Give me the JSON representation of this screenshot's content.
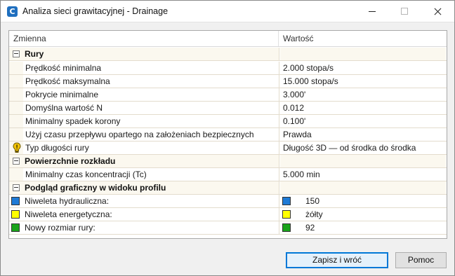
{
  "window": {
    "title": "Analiza sieci grawitacyjnej - Drainage",
    "app_icon": "C",
    "controls": [
      "minimize-icon",
      "maximize-icon",
      "close-icon"
    ]
  },
  "grid": {
    "columns": [
      "Zmienna",
      "Wartość"
    ],
    "categories": [
      {
        "label": "Rury",
        "rows": [
          {
            "label": "Prędkość minimalna",
            "value": "2.000 stopa/s"
          },
          {
            "label": "Prędkość maksymalna",
            "value": "15.000 stopa/s"
          },
          {
            "label": "Pokrycie minimalne",
            "value": "3.000'"
          },
          {
            "label": "Domyślna wartość N",
            "value": "0.012"
          },
          {
            "label": "Minimalny spadek korony",
            "value": "0.100'"
          },
          {
            "label": "Użyj czasu przepływu opartego na założeniach bezpiecznych",
            "value": "Prawda"
          },
          {
            "label": "Typ długości rury",
            "value": "Długość 3D — od środka do środka",
            "icon": "warning-icon"
          }
        ]
      },
      {
        "label": "Powierzchnie rozkładu",
        "rows": [
          {
            "label": "Minimalny czas koncentracji (Tc)",
            "value": "5.000 min"
          }
        ]
      },
      {
        "label": "Podgląd graficzny w widoku profilu",
        "rows": [
          {
            "label": "Niweleta hydrauliczna:",
            "value": "150",
            "color": "#1e7ad6"
          },
          {
            "label": "Niweleta energetyczna:",
            "value": "żółty",
            "color": "#ffff00"
          },
          {
            "label": "Nowy rozmiar rury:",
            "value": "92",
            "color": "#1aa31a"
          }
        ]
      }
    ]
  },
  "buttons": {
    "save_return": "Zapisz i wróć",
    "help": "Pomoc"
  }
}
